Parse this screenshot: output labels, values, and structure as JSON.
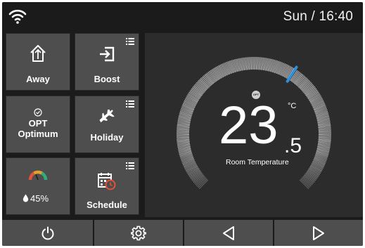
{
  "status_bar": {
    "clock": "Sun / 16:40",
    "wifi_icon": "wifi-icon"
  },
  "tiles": {
    "away": {
      "label": "Away",
      "icon": "away-home-icon"
    },
    "boost": {
      "label": "Boost",
      "icon": "boost-enter-icon",
      "menu_icon": "list-menu-icon"
    },
    "optimum": {
      "code": "OPT",
      "label": "Optimum",
      "icon": "optimum-check-icon"
    },
    "holiday": {
      "label": "Holiday",
      "icon": "airplane-icon",
      "menu_icon": "list-menu-icon"
    },
    "humidity": {
      "value": "45%",
      "icon": "humidity-gauge-icon",
      "drop_icon": "water-drop-icon",
      "gauge_level": 0.45
    },
    "schedule": {
      "label": "Schedule",
      "icon": "calendar-clock-icon",
      "menu_icon": "list-menu-icon"
    }
  },
  "thermostat": {
    "temperature_integer": "23",
    "temperature_decimal": ".5",
    "unit": "°C",
    "label": "Room Temperature",
    "mode_badge": "OPT",
    "setpoint_fraction": 0.62,
    "colors": {
      "dial": "#dcdcdc",
      "setpoint_marker": "#2f8fd8",
      "panel": "#2c2c2c"
    }
  },
  "bottom_bar": {
    "buttons": [
      {
        "name": "power-button",
        "icon": "power-icon"
      },
      {
        "name": "settings-button",
        "icon": "gear-icon"
      },
      {
        "name": "previous-button",
        "icon": "triangle-left-icon"
      },
      {
        "name": "next-button",
        "icon": "triangle-right-icon"
      }
    ]
  }
}
